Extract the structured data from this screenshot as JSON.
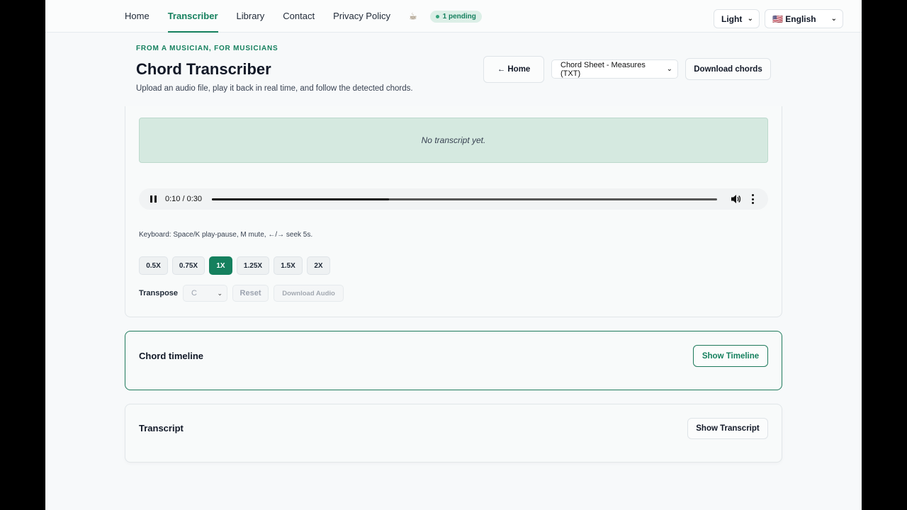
{
  "nav": {
    "links": [
      {
        "label": "Home",
        "active": false
      },
      {
        "label": "Transcriber",
        "active": true
      },
      {
        "label": "Library",
        "active": false
      },
      {
        "label": "Contact",
        "active": false
      },
      {
        "label": "Privacy Policy",
        "active": false
      }
    ],
    "coffee_icon": "☕",
    "pending_label": "1 pending",
    "theme_value": "Light",
    "language_value": "🇺🇸 English"
  },
  "header": {
    "eyebrow": "FROM A MUSICIAN, FOR MUSICIANS",
    "title": "Chord Transcriber",
    "subtitle": "Upload an audio file, play it back in real time, and follow the detected chords.",
    "home_button": "← Home",
    "format_value": "Chord Sheet - Measures (TXT)",
    "download_chords": "Download chords"
  },
  "player": {
    "transcript_placeholder": "No transcript yet.",
    "time": "0:10 / 0:30",
    "progress_fraction": 0.35,
    "keyboard_hint": "Keyboard: Space/K play-pause, M mute, ←/→ seek 5s.",
    "speeds": [
      "0.5X",
      "0.75X",
      "1X",
      "1.25X",
      "1.5X",
      "2X"
    ],
    "active_speed": "1X",
    "transpose_label": "Transpose",
    "transpose_key": "C",
    "reset_label": "Reset",
    "download_audio": "Download Audio"
  },
  "timeline": {
    "title": "Chord timeline",
    "button": "Show Timeline"
  },
  "transcript": {
    "title": "Transcript",
    "button": "Show Transcript"
  },
  "colors": {
    "accent": "#15805e",
    "notice_bg": "#d5e9e0"
  }
}
